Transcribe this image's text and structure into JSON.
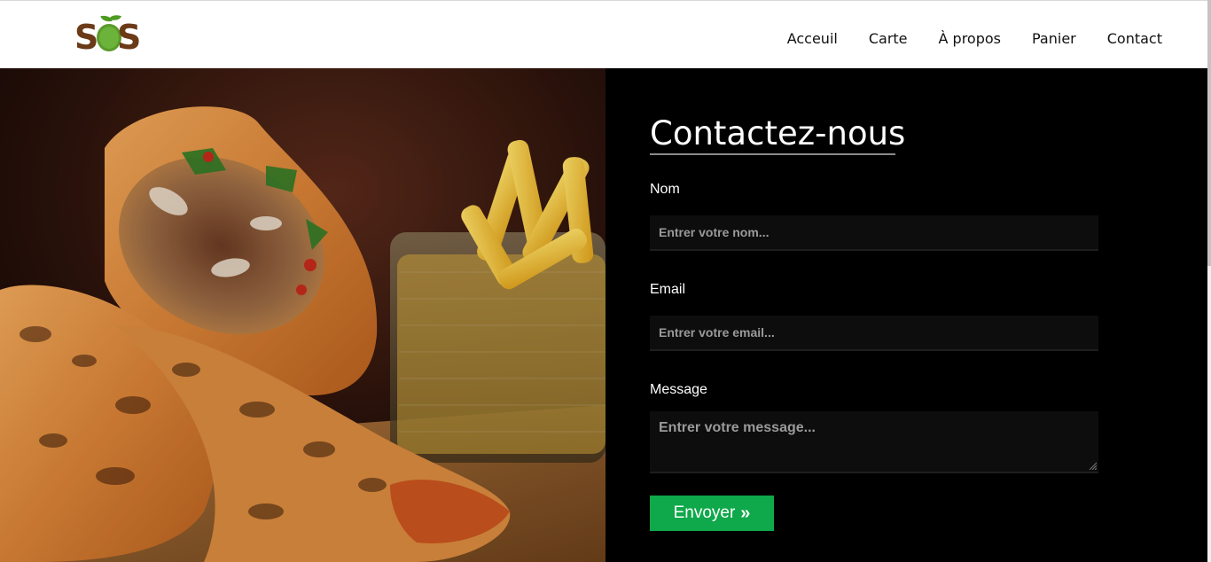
{
  "brand": {
    "logo_text": "SOS",
    "colors": {
      "brown": "#6b3a17",
      "green": "#6bb33a"
    }
  },
  "nav": {
    "items": [
      {
        "label": "Acceuil"
      },
      {
        "label": "Carte"
      },
      {
        "label": "À propos"
      },
      {
        "label": "Panier"
      },
      {
        "label": "Contact"
      }
    ]
  },
  "hero": {
    "image": "photo of grilled wraps and fries in a basket"
  },
  "contact": {
    "title": "Contactez-nous",
    "name": {
      "label": "Nom",
      "placeholder": "Entrer votre nom...",
      "value": ""
    },
    "email": {
      "label": "Email",
      "placeholder": "Entrer votre email...",
      "value": ""
    },
    "message": {
      "label": "Message",
      "placeholder": "Entrer votre message...",
      "value": ""
    },
    "submit": {
      "label": "Envoyer",
      "icon": "double-chevron-right-icon"
    },
    "colors": {
      "background": "#000000",
      "button": "#0fa84a"
    }
  }
}
